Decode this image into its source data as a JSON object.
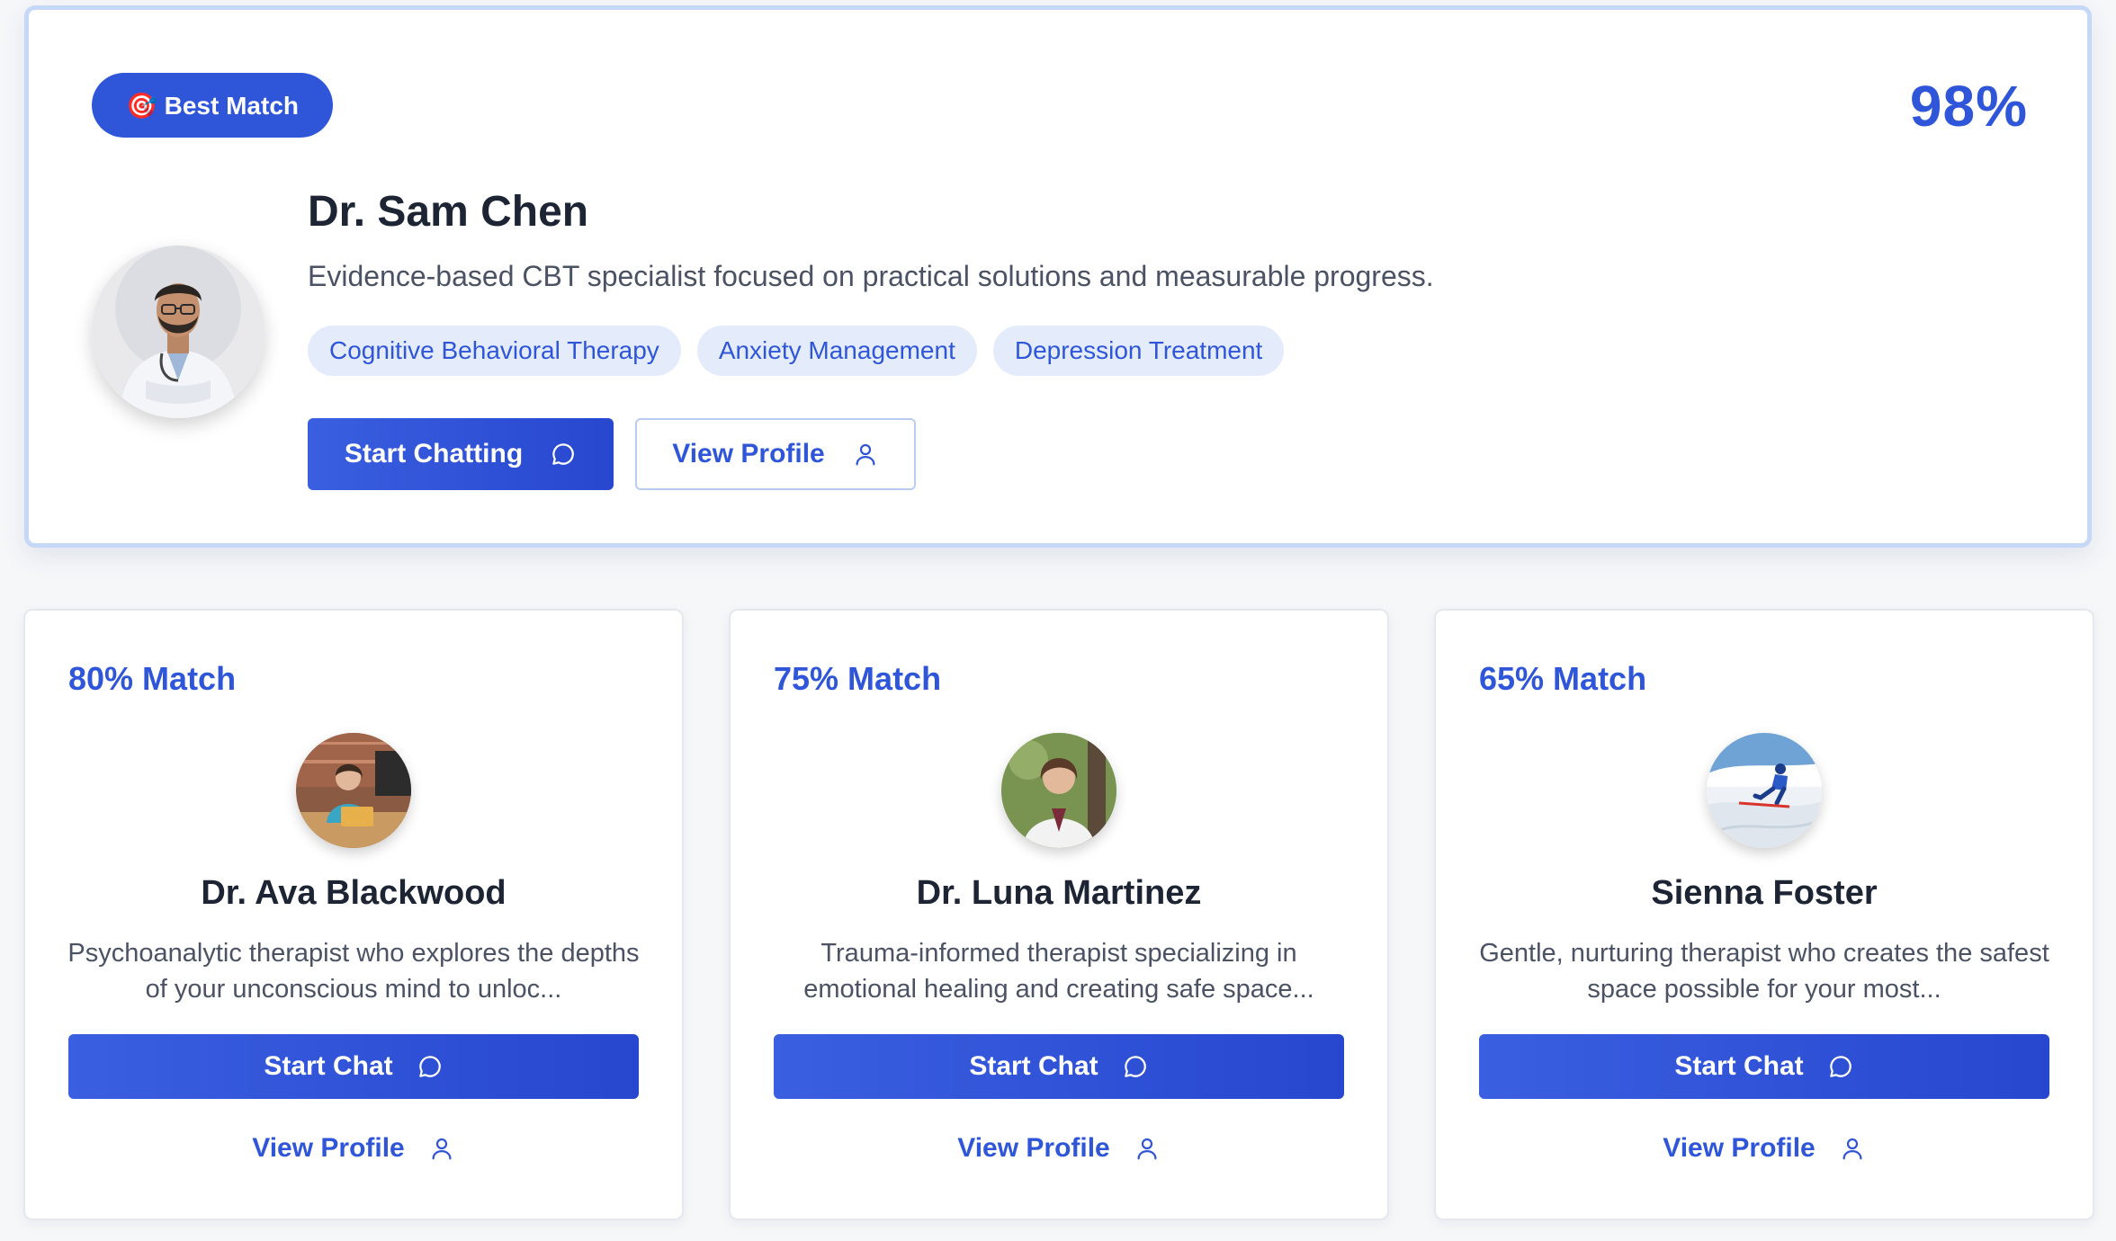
{
  "featured": {
    "badge_label": "🎯 Best Match",
    "match_percent": "98%",
    "name": "Dr. Sam Chen",
    "description": "Evidence-based CBT specialist focused on practical solutions and measurable progress.",
    "tags": [
      "Cognitive Behavioral Therapy",
      "Anxiety Management",
      "Depression Treatment"
    ],
    "primary_button": "Start Chatting",
    "secondary_button": "View Profile",
    "primary_button_icon": "chat-bubble-icon",
    "secondary_button_icon": "user-icon"
  },
  "cards": [
    {
      "match": "80% Match",
      "name": "Dr. Ava Blackwood",
      "description": "Psychoanalytic therapist who explores the depths of your unconscious mind to unloc...",
      "chat_button": "Start Chat",
      "profile_link": "View Profile"
    },
    {
      "match": "75% Match",
      "name": "Dr. Luna Martinez",
      "description": "Trauma-informed therapist specializing in emotional healing and creating safe space...",
      "chat_button": "Start Chat",
      "profile_link": "View Profile"
    },
    {
      "match": "65% Match",
      "name": "Sienna Foster",
      "description": "Gentle, nurturing therapist who creates the safest space possible for your most...",
      "chat_button": "Start Chat",
      "profile_link": "View Profile"
    }
  ],
  "colors": {
    "accent": "#2f56d8",
    "tag_bg": "#e4ecfc",
    "featured_border": "#c6d8f7",
    "text_dark": "#1d2433",
    "text_muted": "#4a5264"
  }
}
